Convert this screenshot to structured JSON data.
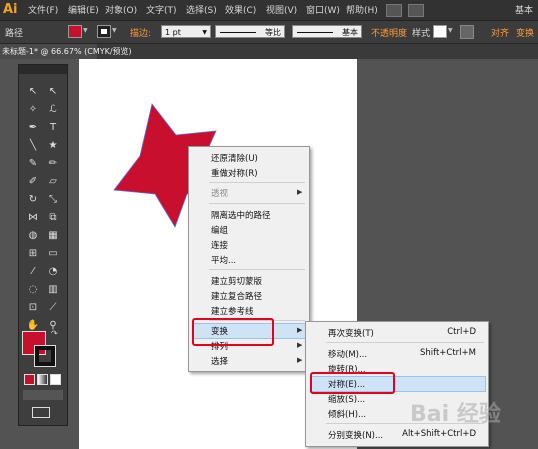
{
  "app": {
    "logo": "Ai"
  },
  "menubar": {
    "items": [
      "文件(F)",
      "编辑(E)",
      "对象(O)",
      "文字(T)",
      "选择(S)",
      "效果(C)",
      "视图(V)",
      "窗口(W)",
      "帮助(H)"
    ],
    "workspace": "基本"
  },
  "control_bar": {
    "object_type": "路径",
    "fill_color": "#c8102e",
    "stroke_label": "描边:",
    "stroke_weight": "1 pt",
    "profile_label": "等比",
    "brush_label": "基本",
    "opacity_label": "不透明度",
    "style_label": "样式",
    "align_label": "对齐",
    "transform_label": "变换"
  },
  "document": {
    "tab_title": "未标题-1* @ 66.67% (CMYK/预览)"
  },
  "artwork": {
    "star_color": "#c8102e",
    "path_color": "#5b6fd6"
  },
  "context_menu": {
    "items": [
      {
        "label": "还原清除(U)"
      },
      {
        "label": "重做对称(R)"
      },
      {
        "label": "透视",
        "disabled": true,
        "submenu": true
      },
      {
        "label": "隔离选中的路径"
      },
      {
        "label": "编组"
      },
      {
        "label": "连接"
      },
      {
        "label": "平均..."
      },
      {
        "label": "建立剪切蒙版"
      },
      {
        "label": "建立复合路径"
      },
      {
        "label": "建立参考线"
      },
      {
        "label": "变换",
        "submenu": true,
        "highlighted": true
      },
      {
        "label": "排列",
        "submenu": true
      },
      {
        "label": "选择",
        "submenu": true
      }
    ]
  },
  "transform_submenu": {
    "items": [
      {
        "label": "再次变换(T)",
        "shortcut": "Ctrl+D"
      },
      {
        "label": "移动(M)...",
        "shortcut": "Shift+Ctrl+M"
      },
      {
        "label": "旋转(R)..."
      },
      {
        "label": "对称(E)...",
        "highlighted": true
      },
      {
        "label": "缩放(S)..."
      },
      {
        "label": "倾斜(H)..."
      },
      {
        "label": "分别变换(N)...",
        "shortcut": "Alt+Shift+Ctrl+D"
      }
    ]
  },
  "watermark": {
    "text": "Bai 经验"
  },
  "colors": {
    "annotation_red": "#e3001b",
    "highlight": "#cfe3f7"
  }
}
